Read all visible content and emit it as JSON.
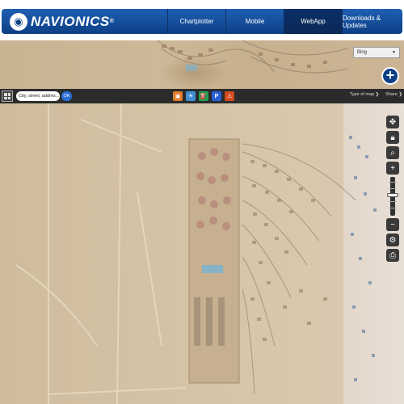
{
  "header": {
    "logo_text": "NAVIONICS",
    "tabs": [
      {
        "label": "Chartplotter"
      },
      {
        "label": "Mobile"
      },
      {
        "label": "WebApp",
        "active": true
      },
      {
        "label": "Downloads & Updates"
      }
    ]
  },
  "map": {
    "base_layer_select": "Bing",
    "plus_label": "+"
  },
  "toolbar": {
    "search_value": "City, street, addres...",
    "ok_label": "OK",
    "layer_icons": [
      "camera-icon",
      "weather-icon",
      "fuel-icon",
      "parking-icon",
      "warning-icon"
    ],
    "type_of_map_label": "Type of map",
    "share_label": "Share"
  },
  "controls": {
    "icons": [
      "pan-icon",
      "lock-icon",
      "magnify-icon",
      "zoom-in-icon",
      "zoom-out-icon",
      "settings-icon",
      "print-icon"
    ],
    "zoom_in": "+",
    "zoom_out": "−"
  },
  "colors": {
    "brand_blue": "#0d3f86",
    "toolbar_dark": "#2b2b2b",
    "sand": "#d9c7a9"
  }
}
